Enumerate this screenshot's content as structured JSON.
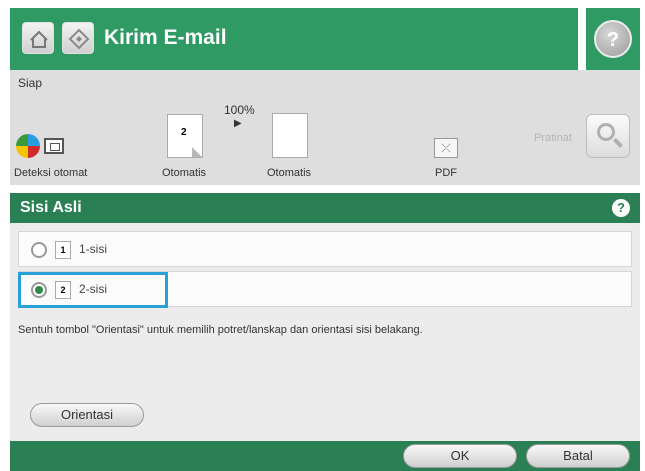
{
  "header": {
    "title": "Kirim E-mail"
  },
  "settings": {
    "status": "Siap",
    "zoom": "100%",
    "items": [
      {
        "label": "Deteksi otomat"
      },
      {
        "label": "Otomatis",
        "doc_number": "2"
      },
      {
        "label": "Otomatis"
      },
      {
        "label": "PDF"
      }
    ],
    "preview_label": "Pratinat"
  },
  "dialog": {
    "title": "Sisi Asli",
    "options": [
      {
        "number": "1",
        "label": "1-sisi",
        "selected": false
      },
      {
        "number": "2",
        "label": "2-sisi",
        "selected": true
      }
    ],
    "instruction": "Sentuh tombol \"Orientasi\" untuk memilih potret/lanskap dan orientasi sisi belakang.",
    "orientasi_label": "Orientasi",
    "ok_label": "OK",
    "cancel_label": "Batal"
  },
  "icons": {
    "home": "home-icon",
    "app": "email-app-icon",
    "help": "help-icon",
    "color": "color-mode-icon",
    "preview": "magnifier-icon"
  },
  "colors": {
    "header_green": "#2f9a63",
    "dialog_green": "#2a7f55",
    "selection_blue": "#2aa0d8"
  }
}
